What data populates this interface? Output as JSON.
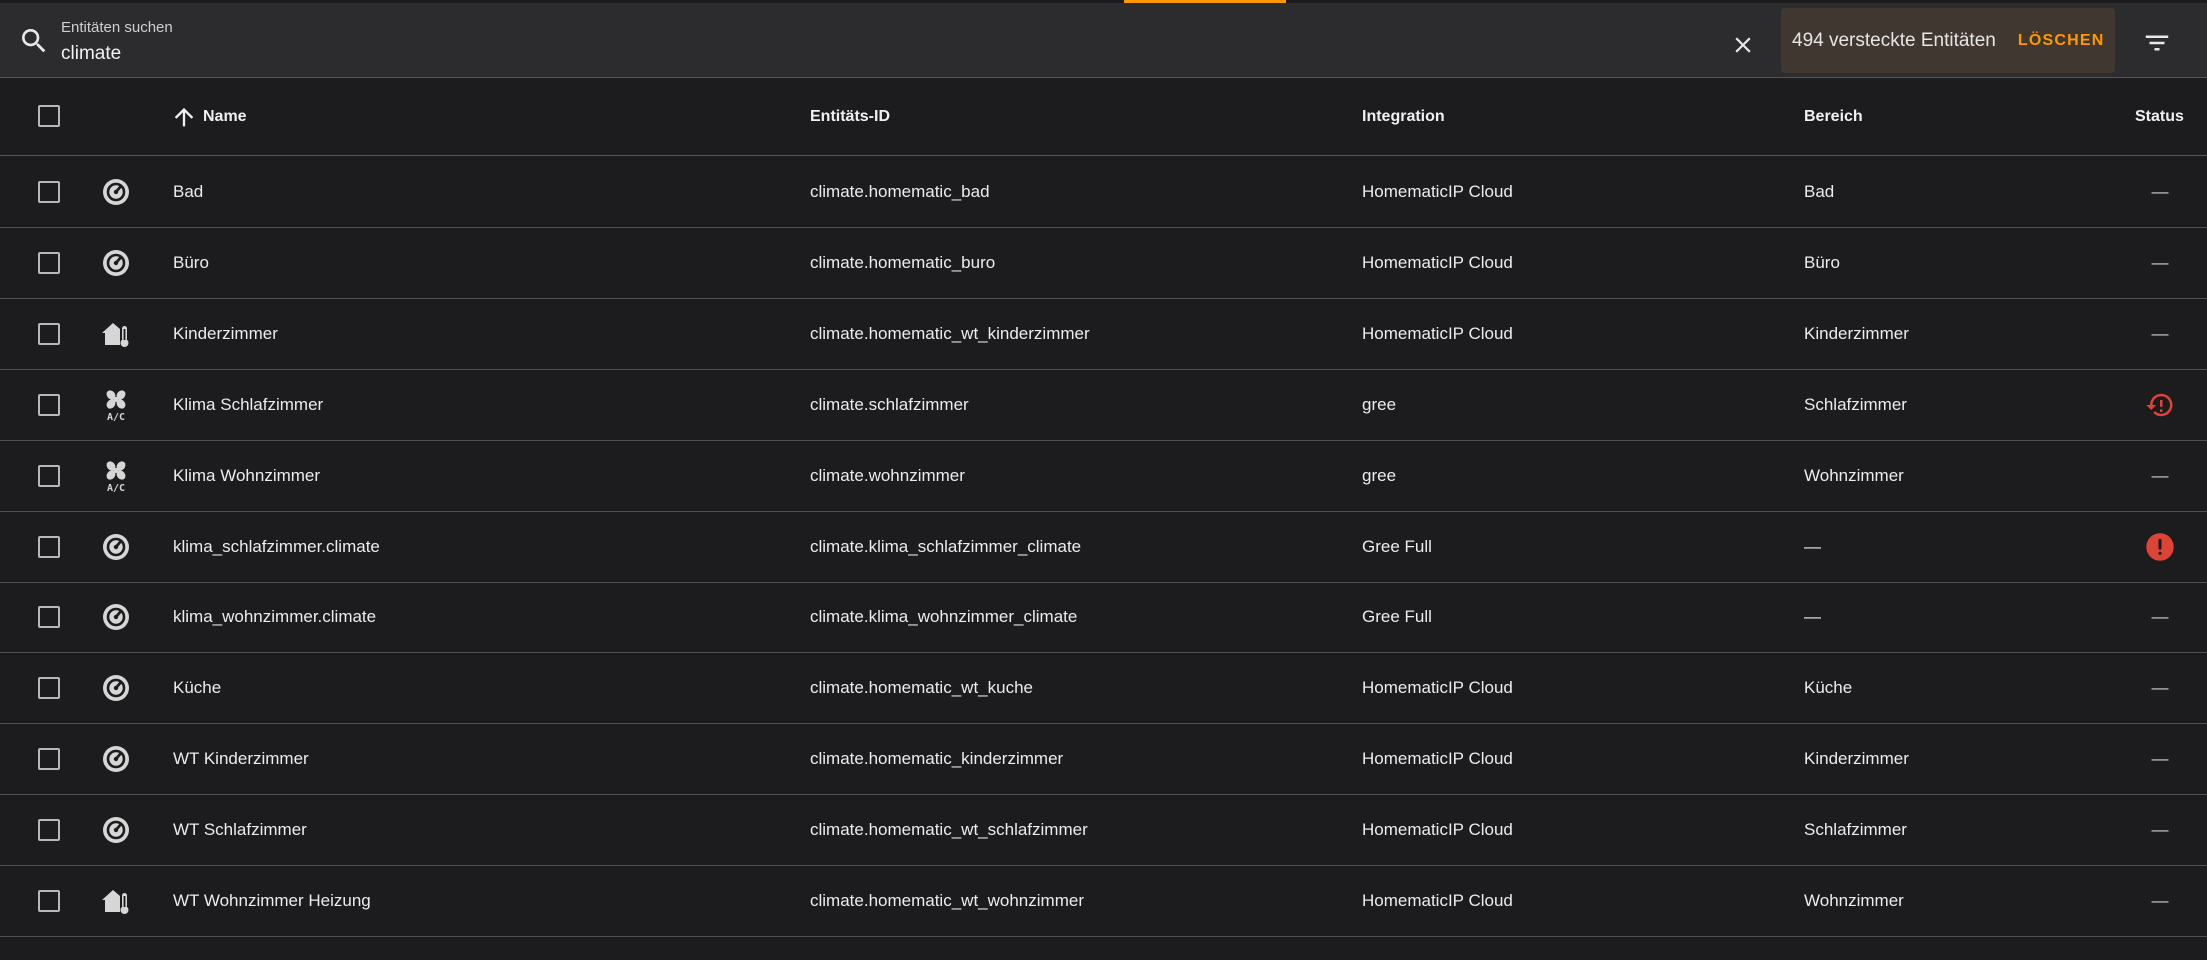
{
  "search": {
    "label": "Entitäten suchen",
    "value": "climate"
  },
  "hidden_filter": {
    "text": "494 versteckte Entitäten",
    "action": "LÖSCHEN"
  },
  "icons": {
    "search": "search-icon",
    "clear": "close-icon",
    "filter": "filter-icon",
    "sort": "arrow-up-icon"
  },
  "columns": {
    "name": "Name",
    "entity_id": "Entitäts-ID",
    "integration": "Integration",
    "area": "Bereich",
    "status": "Status"
  },
  "colors": {
    "accent": "#ff9800",
    "error": "#db4437",
    "background": "#1c1c1e",
    "toolbar": "#2c2c2e"
  },
  "rows": [
    {
      "icon": "thermostat-icon",
      "name": "Bad",
      "entity_id": "climate.homematic_bad",
      "integration": "HomematicIP Cloud",
      "area": "Bad",
      "status": "—",
      "status_icon": ""
    },
    {
      "icon": "thermostat-icon",
      "name": "Büro",
      "entity_id": "climate.homematic_buro",
      "integration": "HomematicIP Cloud",
      "area": "Büro",
      "status": "—",
      "status_icon": ""
    },
    {
      "icon": "home-thermometer-icon",
      "name": "Kinderzimmer",
      "entity_id": "climate.homematic_wt_kinderzimmer",
      "integration": "HomematicIP Cloud",
      "area": "Kinderzimmer",
      "status": "—",
      "status_icon": ""
    },
    {
      "icon": "air-conditioner-icon",
      "name": "Klima Schlafzimmer",
      "entity_id": "climate.schlafzimmer",
      "integration": "gree",
      "area": "Schlafzimmer",
      "status": "",
      "status_icon": "restore-alert-icon"
    },
    {
      "icon": "air-conditioner-icon",
      "name": "Klima Wohnzimmer",
      "entity_id": "climate.wohnzimmer",
      "integration": "gree",
      "area": "Wohnzimmer",
      "status": "—",
      "status_icon": ""
    },
    {
      "icon": "thermostat-icon",
      "name": "klima_schlafzimmer.climate",
      "entity_id": "climate.klima_schlafzimmer_climate",
      "integration": "Gree Full",
      "area": "—",
      "status": "",
      "status_icon": "alert-circle-icon"
    },
    {
      "icon": "thermostat-icon",
      "name": "klima_wohnzimmer.climate",
      "entity_id": "climate.klima_wohnzimmer_climate",
      "integration": "Gree Full",
      "area": "—",
      "status": "—",
      "status_icon": ""
    },
    {
      "icon": "thermostat-icon",
      "name": "Küche",
      "entity_id": "climate.homematic_wt_kuche",
      "integration": "HomematicIP Cloud",
      "area": "Küche",
      "status": "—",
      "status_icon": ""
    },
    {
      "icon": "thermostat-icon",
      "name": "WT Kinderzimmer",
      "entity_id": "climate.homematic_kinderzimmer",
      "integration": "HomematicIP Cloud",
      "area": "Kinderzimmer",
      "status": "—",
      "status_icon": ""
    },
    {
      "icon": "thermostat-icon",
      "name": "WT Schlafzimmer",
      "entity_id": "climate.homematic_wt_schlafzimmer",
      "integration": "HomematicIP Cloud",
      "area": "Schlafzimmer",
      "status": "—",
      "status_icon": ""
    },
    {
      "icon": "home-thermometer-icon",
      "name": "WT Wohnzimmer Heizung",
      "entity_id": "climate.homematic_wt_wohnzimmer",
      "integration": "HomematicIP Cloud",
      "area": "Wohnzimmer",
      "status": "—",
      "status_icon": ""
    }
  ]
}
